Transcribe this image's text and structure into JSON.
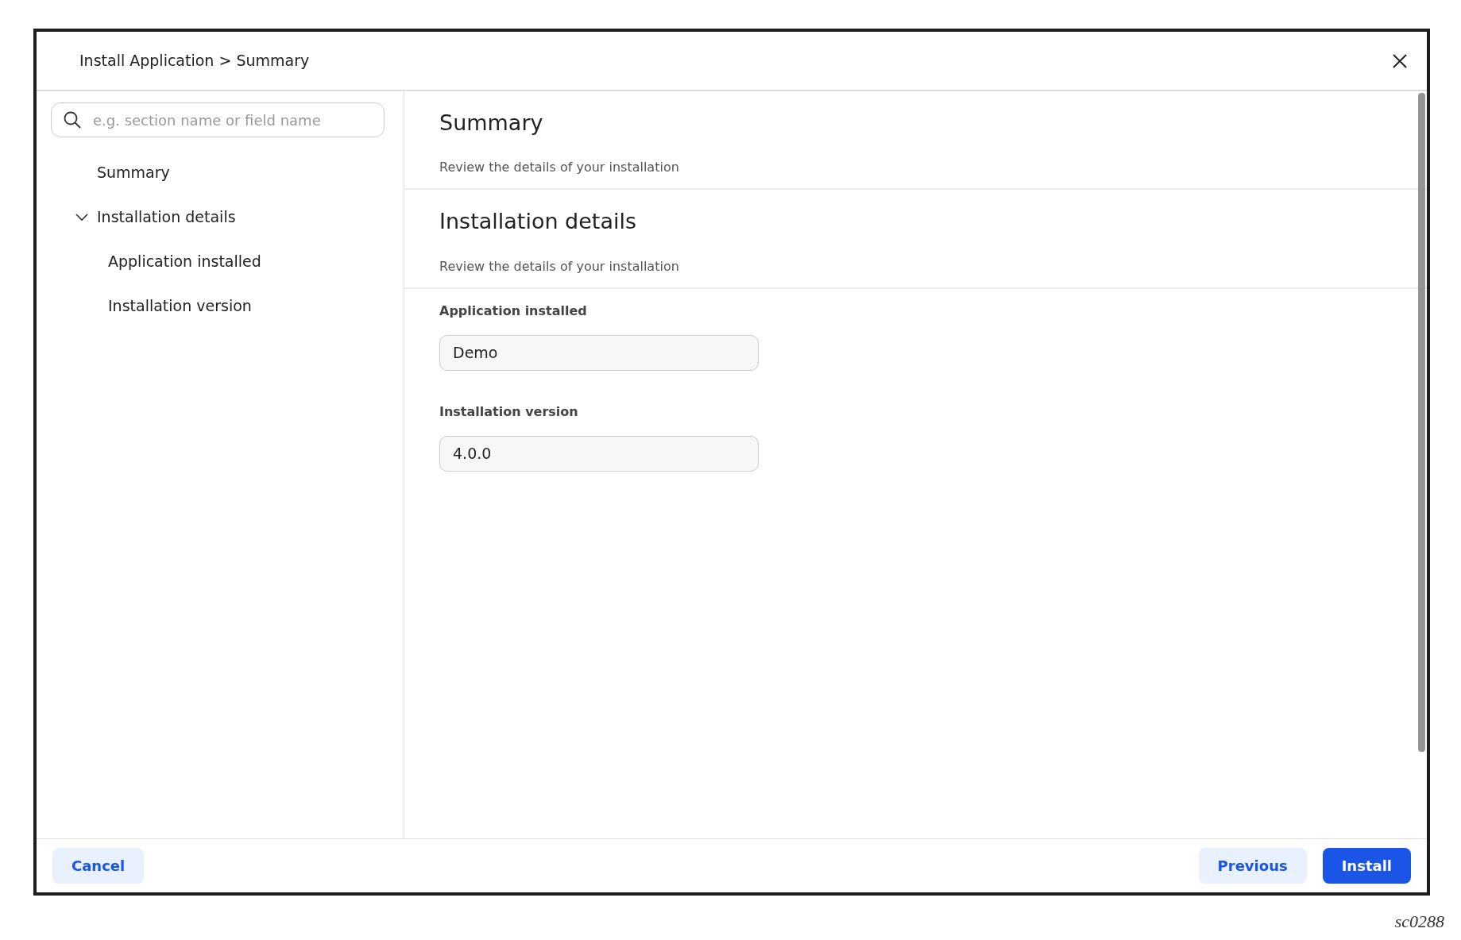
{
  "dialog": {
    "title": "Install Application > Summary"
  },
  "sidebar": {
    "search": {
      "placeholder": "e.g. section name or field name"
    },
    "items": [
      {
        "label": "Summary"
      },
      {
        "label": "Installation details",
        "expanded": true,
        "children": [
          {
            "label": "Application installed"
          },
          {
            "label": "Installation version"
          }
        ]
      }
    ]
  },
  "sections": [
    {
      "title": "Summary",
      "description": "Review the details of your installation"
    },
    {
      "title": "Installation details",
      "description": "Review the details of your installation",
      "fields": [
        {
          "label": "Application installed",
          "value": "Demo"
        },
        {
          "label": "Installation version",
          "value": "4.0.0"
        }
      ]
    }
  ],
  "footer": {
    "buttons": [
      {
        "label": "Cancel",
        "kind": "secondary"
      },
      {
        "label": "Previous",
        "kind": "secondary"
      },
      {
        "label": "Install",
        "kind": "primary"
      }
    ]
  },
  "figure_label": "sc0288"
}
